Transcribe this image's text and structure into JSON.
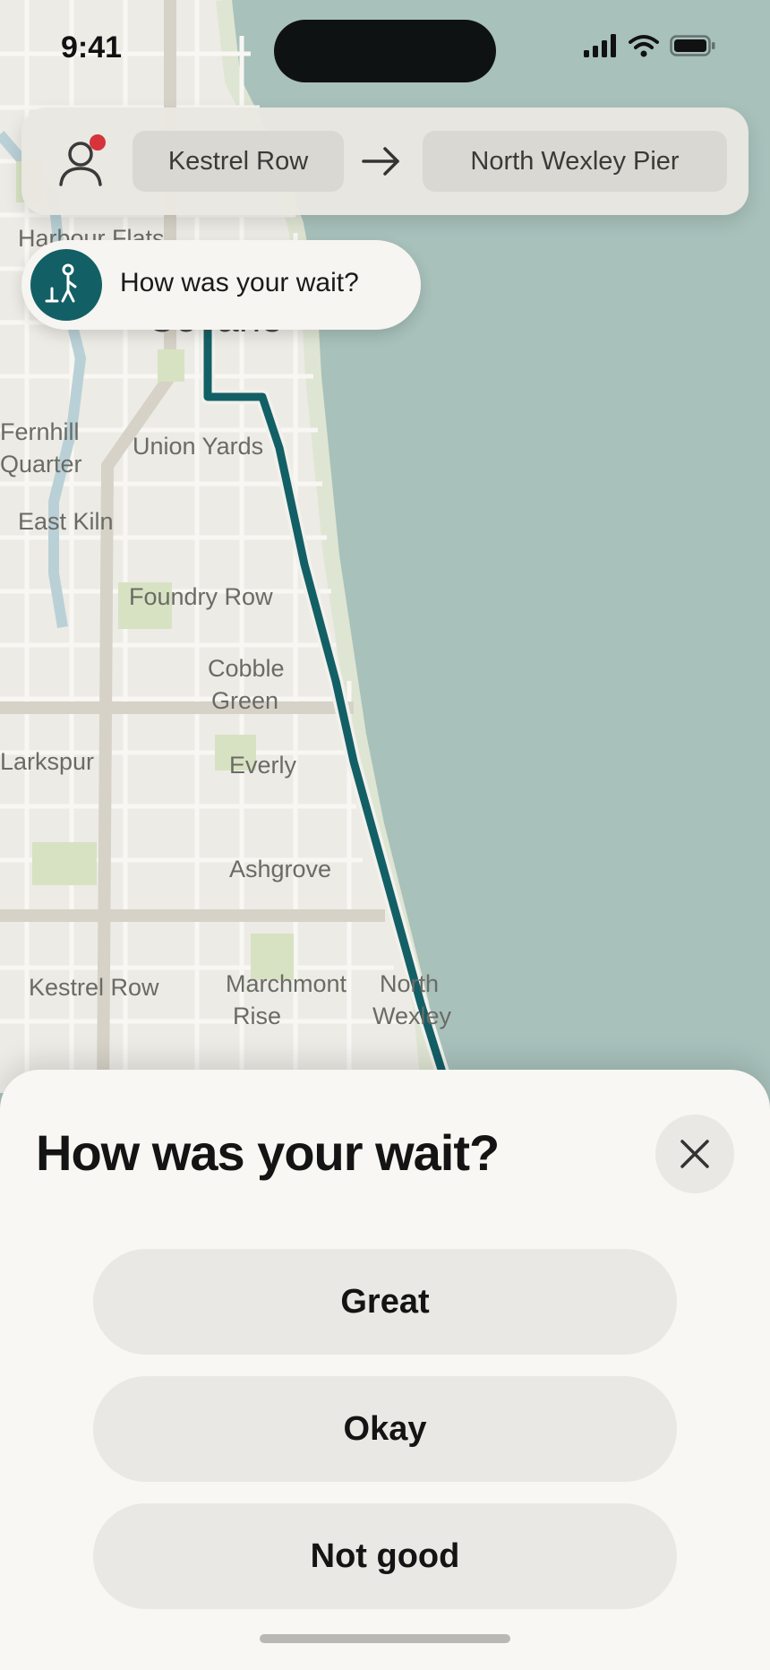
{
  "status_bar": {
    "time": "9:41"
  },
  "route": {
    "from": "Kestrel Row",
    "to": "North Wexley Pier"
  },
  "map": {
    "labels": [
      "Harbour Flats",
      "Covane",
      "Fernhill",
      "Quarter",
      "Union Yards",
      "East Kiln",
      "Foundry Row",
      "Cobble",
      "Green",
      "Larkspur",
      "Everly",
      "Ashgrove",
      "Kestrel Row",
      "Marchmont",
      "Rise",
      "North",
      "Wexley"
    ]
  },
  "wait_bubble": {
    "text": "How was your wait?"
  },
  "sheet": {
    "title": "How was your wait?",
    "options": [
      "Great",
      "Okay",
      "Not good"
    ]
  },
  "colors": {
    "route": "#135f66",
    "water": "#a8c1bb",
    "land": "#ecebe5",
    "alert_dot": "#d6333a"
  }
}
